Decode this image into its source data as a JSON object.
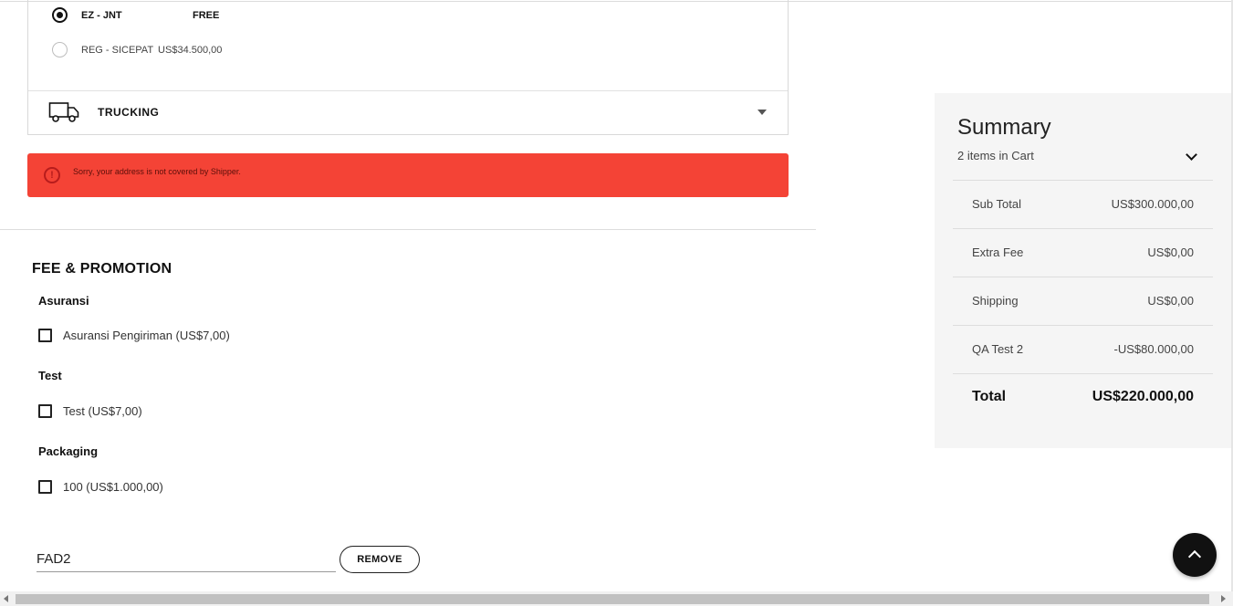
{
  "shipping": {
    "options": [
      {
        "name": "EZ - JNT",
        "price": "FREE",
        "selected": true
      },
      {
        "name": "REG - SICEPAT",
        "price": "US$34.500,00",
        "selected": false
      }
    ],
    "trucking_label": "TRUCKING"
  },
  "alert": {
    "message": "Sorry, your address is not covered by Shipper.",
    "icon": "exclamation-circle-icon",
    "color": "#f44336"
  },
  "fee_promotion": {
    "title": "FEE & PROMOTION",
    "groups": [
      {
        "title": "Asuransi",
        "option": "Asuransi Pengiriman (US$7,00)",
        "checked": false
      },
      {
        "title": "Test",
        "option": "Test (US$7,00)",
        "checked": false
      },
      {
        "title": "Packaging",
        "option": "100 (US$1.000,00)",
        "checked": false
      }
    ]
  },
  "promo": {
    "code": "FAD2",
    "remove_label": "REMOVE"
  },
  "summary": {
    "title": "Summary",
    "items_in_cart": "2 items in Cart",
    "rows": [
      {
        "label": "Sub Total",
        "value": "US$300.000,00"
      },
      {
        "label": "Extra Fee",
        "value": "US$0,00"
      },
      {
        "label": "Shipping",
        "value": "US$0,00"
      },
      {
        "label": "QA Test 2",
        "value": "-US$80.000,00"
      }
    ],
    "total_label": "Total",
    "total_value": "US$220.000,00"
  }
}
